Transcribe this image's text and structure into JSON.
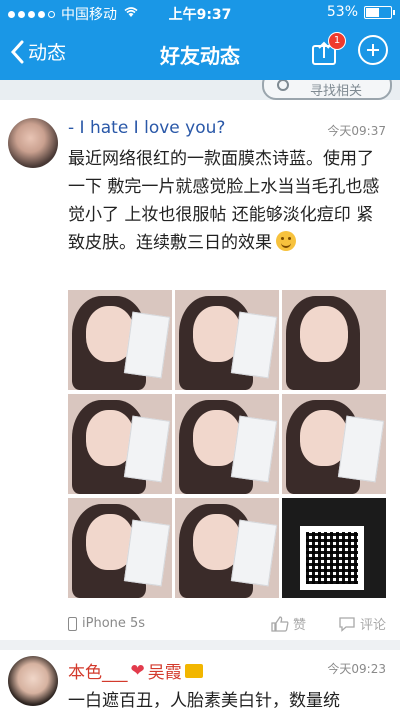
{
  "status_bar": {
    "carrier": "中国移动",
    "time": "上午9:37",
    "battery_percent": "53%",
    "signal_icon": "signal-dots-icon",
    "wifi_icon": "wifi-icon",
    "battery_icon": "battery-icon"
  },
  "nav": {
    "back_label": "动态",
    "title": "好友动态",
    "share_badge": "1",
    "colors": {
      "bar": "#1a97e6",
      "badge": "#ef3a2d"
    }
  },
  "subbar": {
    "find_label": "寻找相关"
  },
  "post": {
    "username": "- I hate I love you?",
    "time": "今天09:37",
    "content": "最近网络很红的一款面膜杰诗蓝。使用了一下 敷完一片就感觉脸上水当当毛孔也感觉小了 上妆也很服帖 还能够淡化痘印 紧致皮肤。连续敷三日的效果",
    "device": "iPhone 5s",
    "like_label": "赞",
    "comment_label": "评论",
    "photo_count": 9
  },
  "post2": {
    "username": "本色___",
    "username_suffix": "吴霞",
    "time": "今天09:23",
    "content": "一白遮百丑，人胎素美白针，数量统"
  }
}
